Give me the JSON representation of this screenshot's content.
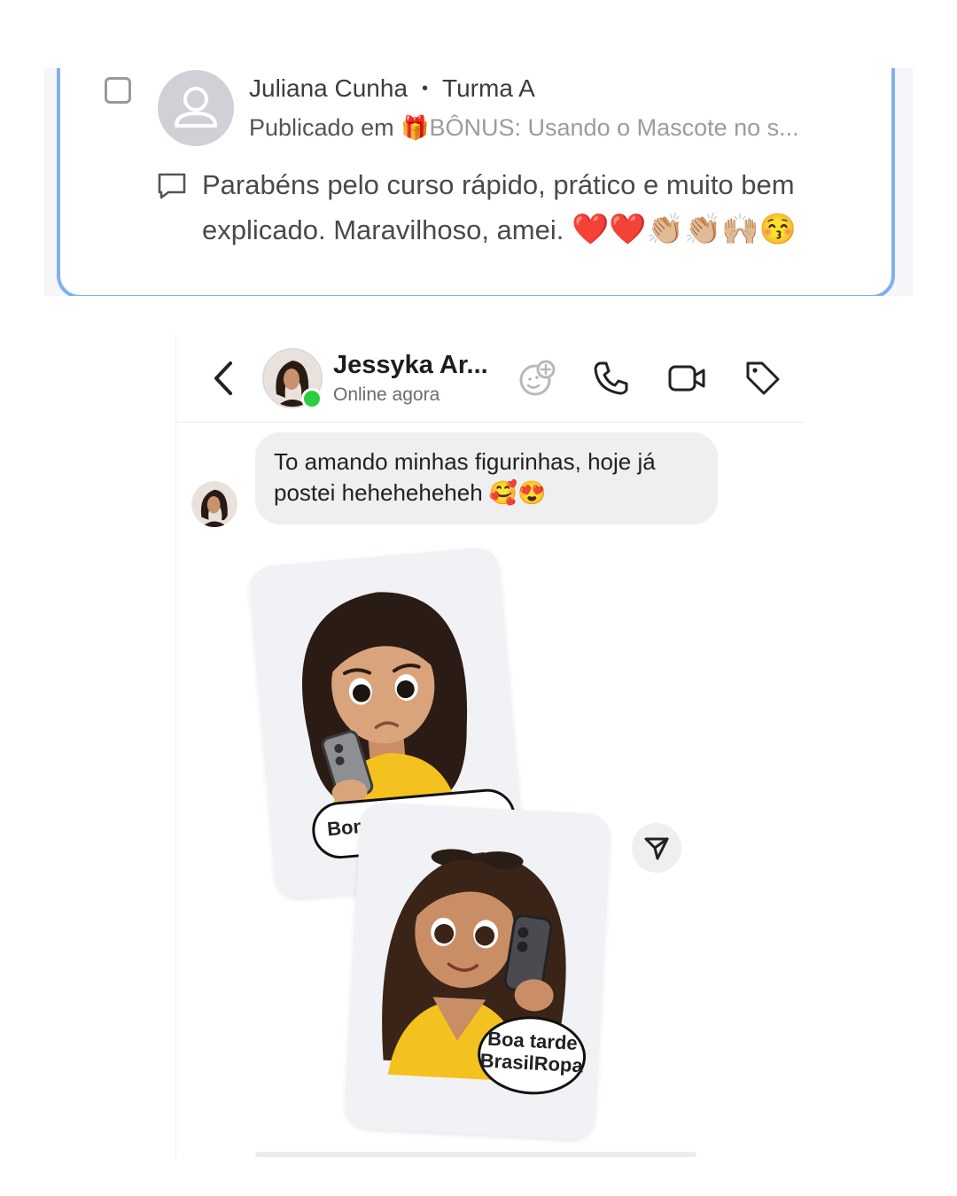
{
  "comment_card": {
    "author": "Juliana Cunha",
    "separator": "•",
    "group": "Turma A",
    "posted_in_label": "Publicado em",
    "course_icon": "gift-emoji",
    "course_title": "BÔNUS: Usando o Mascote no s...",
    "comment_text": "Parabéns pelo curso rápido, prático e muito bem explicado. Maravilhoso, amei.",
    "comment_emojis": "❤️❤️👏🏼👏🏼🙌🏼😚",
    "colors": {
      "card_border": "#7db1ee",
      "muted_text": "#9b9ba0"
    }
  },
  "chat": {
    "contact_name": "Jessyka Ar...",
    "contact_status": "Online agora",
    "header_icons": [
      "sticker-add-icon",
      "phone-icon",
      "video-camera-icon",
      "tag-icon"
    ],
    "message_text": "To amando minhas figurinhas, hoje já postei heheheheheh 🥰😍",
    "stickers": [
      {
        "caption": "Bom d",
        "icon": "sticker-sad-girl-phone"
      },
      {
        "caption_line1": "Boa tarde",
        "caption_line2": "BrasilRopa",
        "icon": "sticker-smiling-girl-phone"
      }
    ],
    "colors": {
      "online": "#2ecc40",
      "bubble": "#efeff1",
      "shirt": "#f4c21f"
    }
  }
}
